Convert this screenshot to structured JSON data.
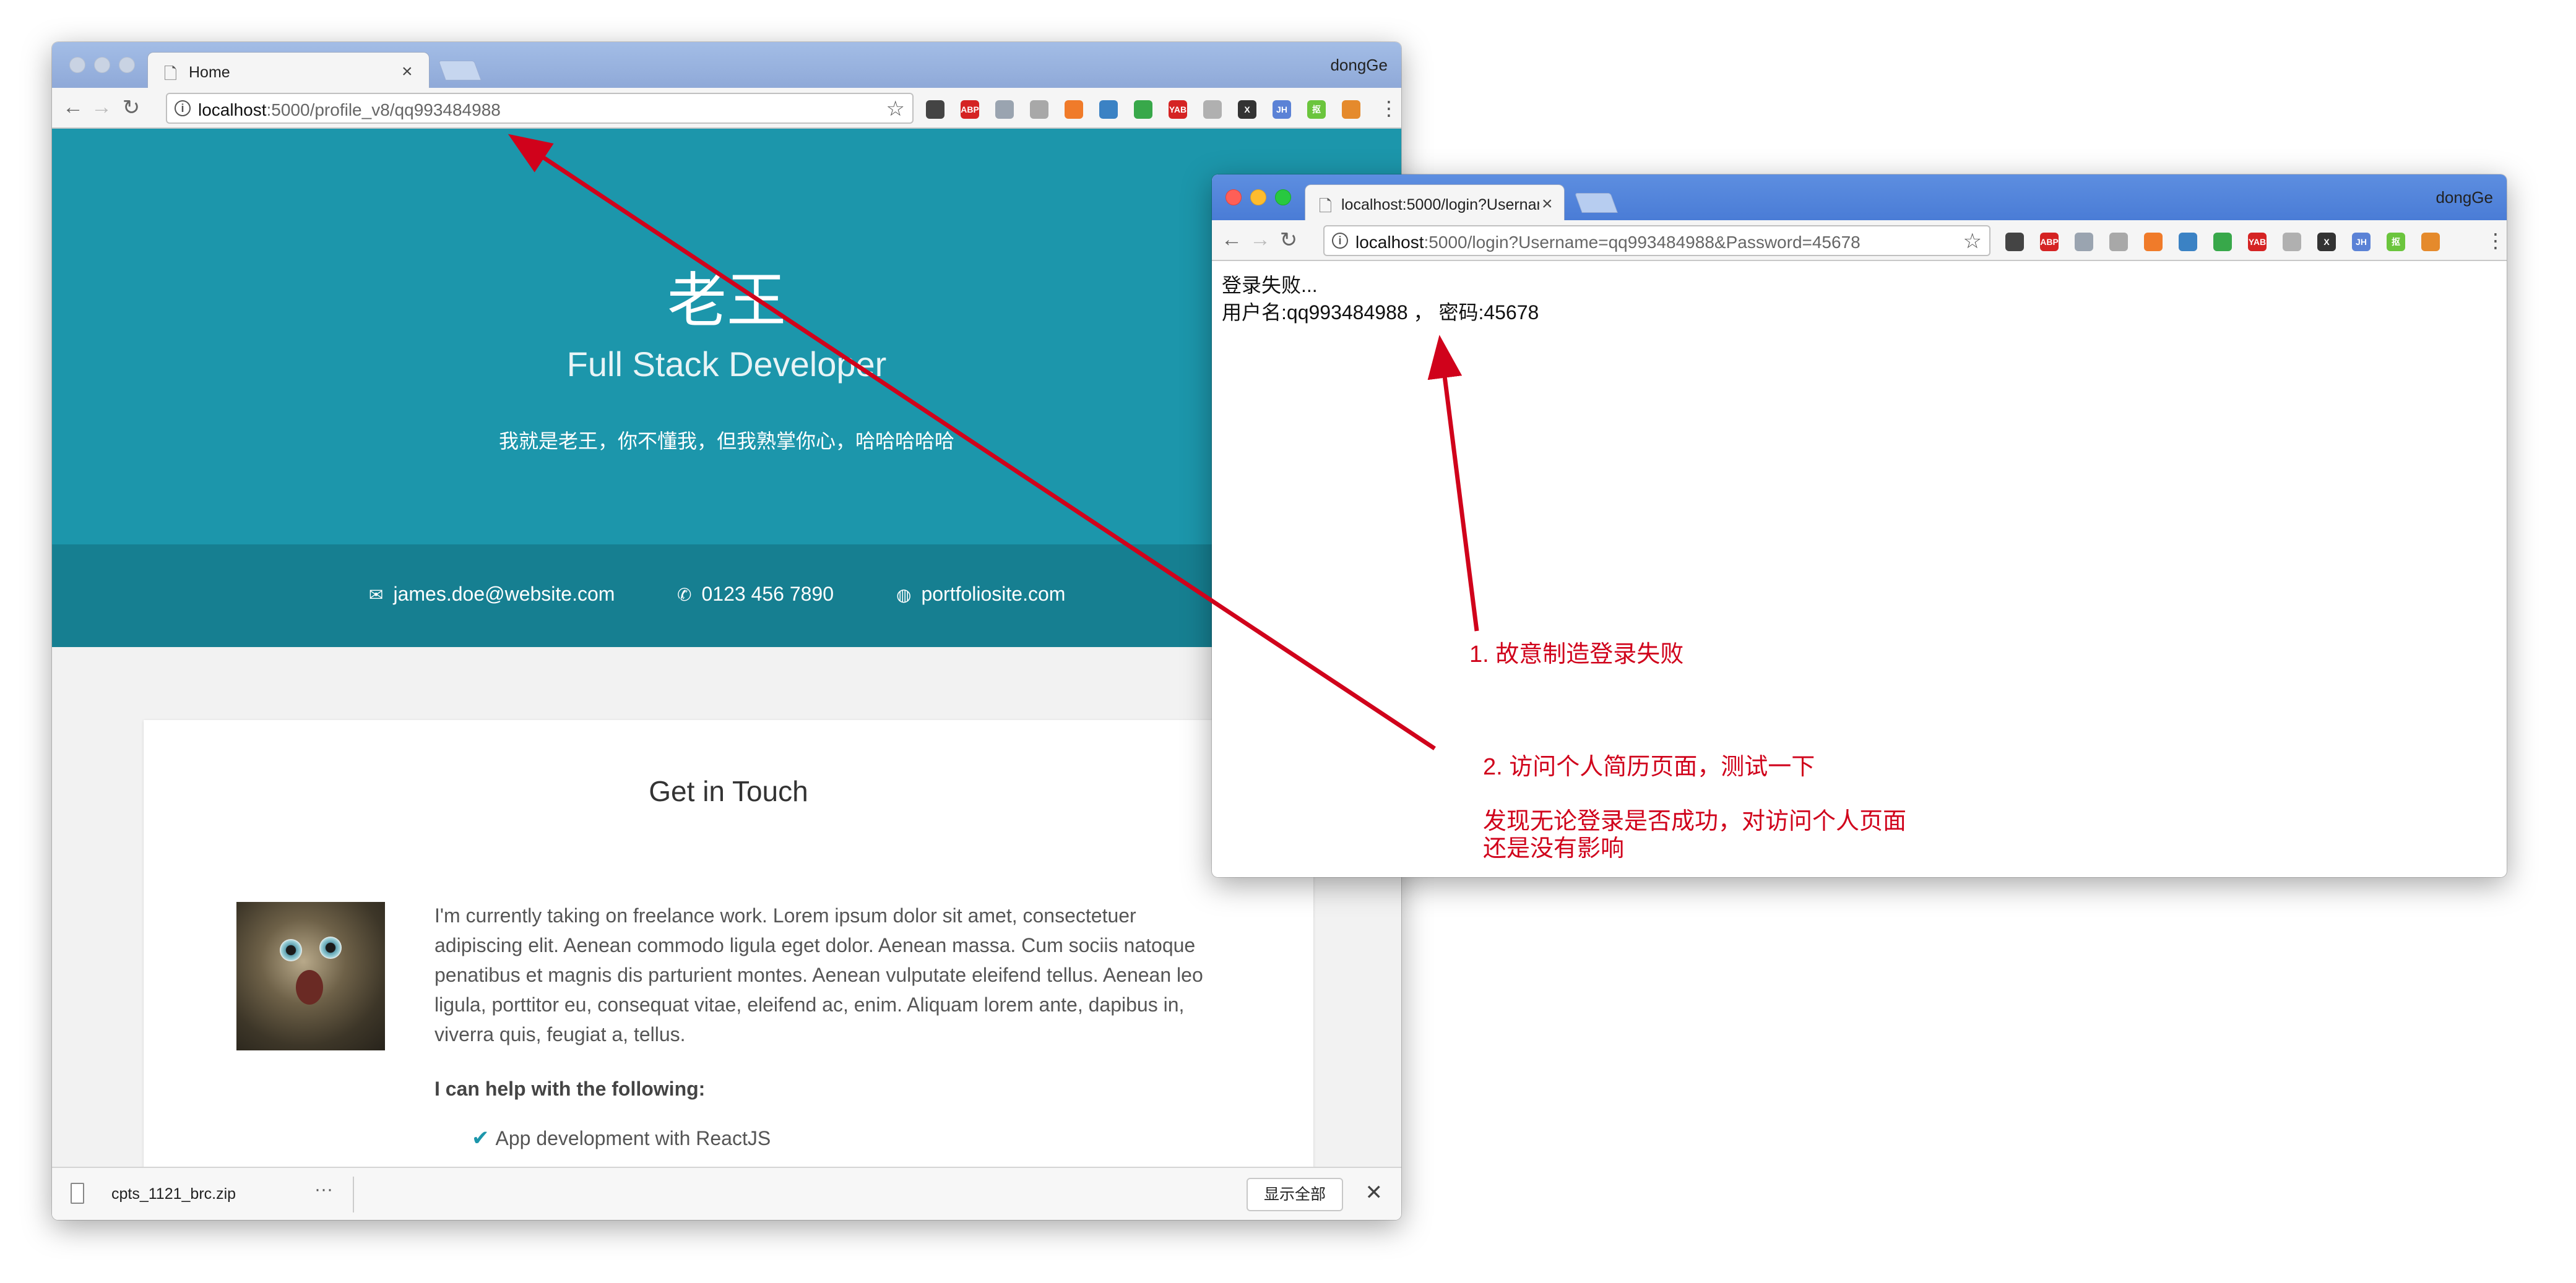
{
  "left_browser": {
    "tab_title": "Home",
    "profile_name": "dongGe",
    "url_host": "localhost",
    "url_path": ":5000/profile_v8/qq993484988",
    "extensions": [
      {
        "name": "qr-code-extension-icon",
        "label": "",
        "color": "#444444"
      },
      {
        "name": "adblock-plus-extension-icon",
        "label": "ABP",
        "color": "#d52323"
      },
      {
        "name": "globe-extension-icon",
        "label": "",
        "color": "#9aa4b0"
      },
      {
        "name": "page-extension-icon",
        "label": "",
        "color": "#a8a8a8"
      },
      {
        "name": "orange-extension-icon",
        "label": "",
        "color": "#f07b2a"
      },
      {
        "name": "skype-extension-icon",
        "label": "",
        "color": "#3b82c4"
      },
      {
        "name": "shield-extension-icon",
        "label": "",
        "color": "#38a84a"
      },
      {
        "name": "yab-extension-icon",
        "label": "YAB",
        "color": "#d52323"
      },
      {
        "name": "ghost-extension-icon",
        "label": "",
        "color": "#b0b0b0"
      },
      {
        "name": "x-extension-icon",
        "label": "X",
        "color": "#333333"
      },
      {
        "name": "jh-extension-icon",
        "label": "JH",
        "color": "#5b82d6"
      },
      {
        "name": "green-extension-icon",
        "label": "抠",
        "color": "#6bc53d"
      },
      {
        "name": "fox-extension-icon",
        "label": "",
        "color": "#e58a2c"
      }
    ],
    "page": {
      "name": "老王",
      "title": "Full Stack Developer",
      "description": "我就是老王，你不懂我，但我熟掌你心，哈哈哈哈哈",
      "contacts": [
        {
          "icon": "envelope-icon",
          "text": "james.doe@website.com"
        },
        {
          "icon": "phone-icon",
          "text": "0123 456 7890"
        },
        {
          "icon": "globe-icon",
          "text": "portfoliosite.com"
        }
      ],
      "section_heading": "Get in Touch",
      "paragraph": "I'm currently taking on freelance work. Lorem ipsum dolor sit amet, consectetuer adipiscing elit. Aenean commodo ligula eget dolor. Aenean massa. Cum sociis natoque penatibus et magnis dis parturient montes. Aenean vulputate eleifend tellus. Aenean leo ligula, porttitor eu, consequat vitae, eleifend ac, enim. Aliquam lorem ante, dapibus in, viverra quis, feugiat a, tellus.",
      "help_heading": "I can help with the following:",
      "help_items": [
        "App development with ReactJS"
      ]
    },
    "download_bar": {
      "file_name": "cpts_1121_brc.zip",
      "more_label": "···",
      "show_all_label": "显示全部",
      "close_label": "✕"
    }
  },
  "right_browser": {
    "tab_title": "localhost:5000/login?Usernam",
    "profile_name": "dongGe",
    "url_host": "localhost",
    "url_path": ":5000/login?Username=qq993484988&Password=45678",
    "page": {
      "line1": "登录失败...",
      "line2": "用户名:qq993484988 ，  密码:45678"
    }
  },
  "annotations": {
    "note1": "1. 故意制造登录失败",
    "note2": "2. 访问个人简历页面，测试一下",
    "note3_line1": "发现无论登录是否成功，对访问个人页面",
    "note3_line2": "还是没有影响",
    "arrow_color": "#d0021b"
  }
}
